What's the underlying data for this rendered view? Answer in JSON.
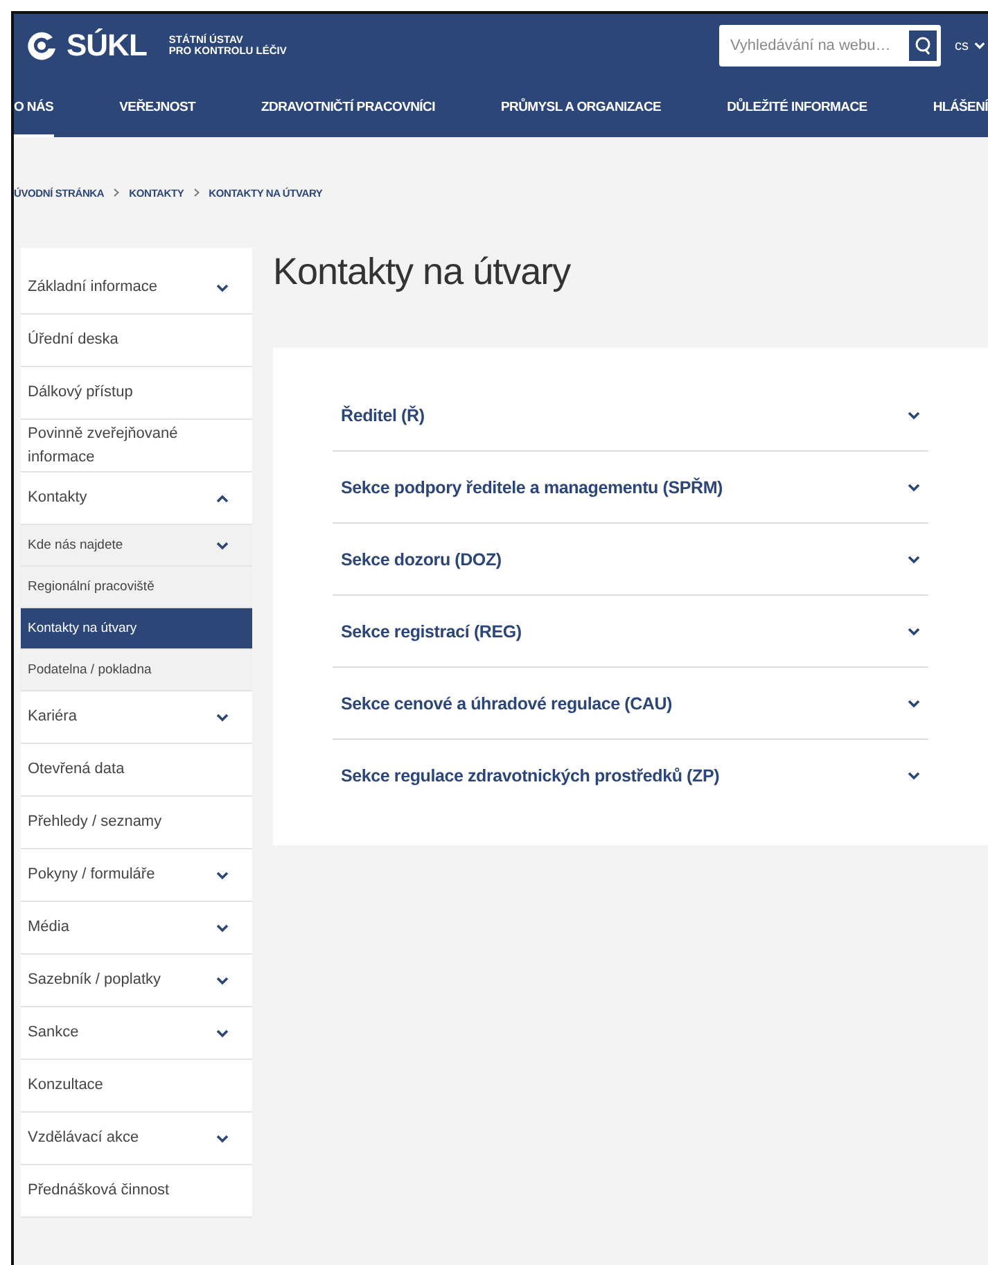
{
  "header": {
    "logo_text": "SÚKL",
    "logo_subtitle": [
      "STÁTNÍ ÚSTAV",
      "PRO KONTROLU LÉČIV"
    ],
    "search": {
      "placeholder": "Vyhledávání na webu…"
    },
    "language": "cs"
  },
  "nav": [
    {
      "label": "O NÁS",
      "selected": true
    },
    {
      "label": "VEŘEJNOST",
      "selected": false
    },
    {
      "label": "ZDRAVOTNIČTÍ PRACOVNÍCI",
      "selected": false
    },
    {
      "label": "PRŮMYSL A ORGANIZACE",
      "selected": false
    },
    {
      "label": "DŮLEŽITÉ INFORMACE",
      "selected": false
    },
    {
      "label": "HLÁŠENÍ",
      "selected": false
    }
  ],
  "breadcrumb": [
    "ÚVODNÍ STRÁNKA",
    "KONTAKTY",
    "KONTAKTY NA ÚTVARY"
  ],
  "sidebar": {
    "items": [
      {
        "label": "Základní informace",
        "kind": "group",
        "expanded": false
      },
      {
        "label": "Úřední deska",
        "kind": "link"
      },
      {
        "label": "Dálkový přístup",
        "kind": "link"
      },
      {
        "label": "Povinně zveřejňované informace",
        "kind": "link"
      },
      {
        "label": "Kontakty",
        "kind": "group",
        "expanded": true,
        "children": [
          {
            "label": "Kde nás najdete",
            "kind": "group",
            "expanded": false,
            "selected": false
          },
          {
            "label": "Regionální pracoviště",
            "kind": "link",
            "selected": false
          },
          {
            "label": "Kontakty na útvary",
            "kind": "link",
            "selected": true
          },
          {
            "label": "Podatelna / pokladna",
            "kind": "link",
            "selected": false
          }
        ]
      },
      {
        "label": "Kariéra",
        "kind": "group",
        "expanded": false
      },
      {
        "label": "Otevřená data",
        "kind": "link"
      },
      {
        "label": "Přehledy / seznamy",
        "kind": "link"
      },
      {
        "label": "Pokyny / formuláře",
        "kind": "group",
        "expanded": false
      },
      {
        "label": "Média",
        "kind": "group",
        "expanded": false
      },
      {
        "label": "Sazebník / poplatky",
        "kind": "group",
        "expanded": false
      },
      {
        "label": "Sankce",
        "kind": "group",
        "expanded": false
      },
      {
        "label": "Konzultace",
        "kind": "link"
      },
      {
        "label": "Vzdělávací akce",
        "kind": "group",
        "expanded": false
      },
      {
        "label": "Přednášková činnost",
        "kind": "link"
      }
    ]
  },
  "page_title": "Kontakty na útvary",
  "accordion": [
    {
      "title": "Ředitel (Ř)",
      "expanded": false
    },
    {
      "title": "Sekce podpory ředitele a managementu (SPŘM)",
      "expanded": false
    },
    {
      "title": "Sekce dozoru (DOZ)",
      "expanded": false
    },
    {
      "title": "Sekce registrací (REG)",
      "expanded": false
    },
    {
      "title": "Sekce cenové a úhradové regulace (CAU)",
      "expanded": false
    },
    {
      "title": "Sekce regulace zdravotnických prostředků (ZP)",
      "expanded": false
    }
  ]
}
